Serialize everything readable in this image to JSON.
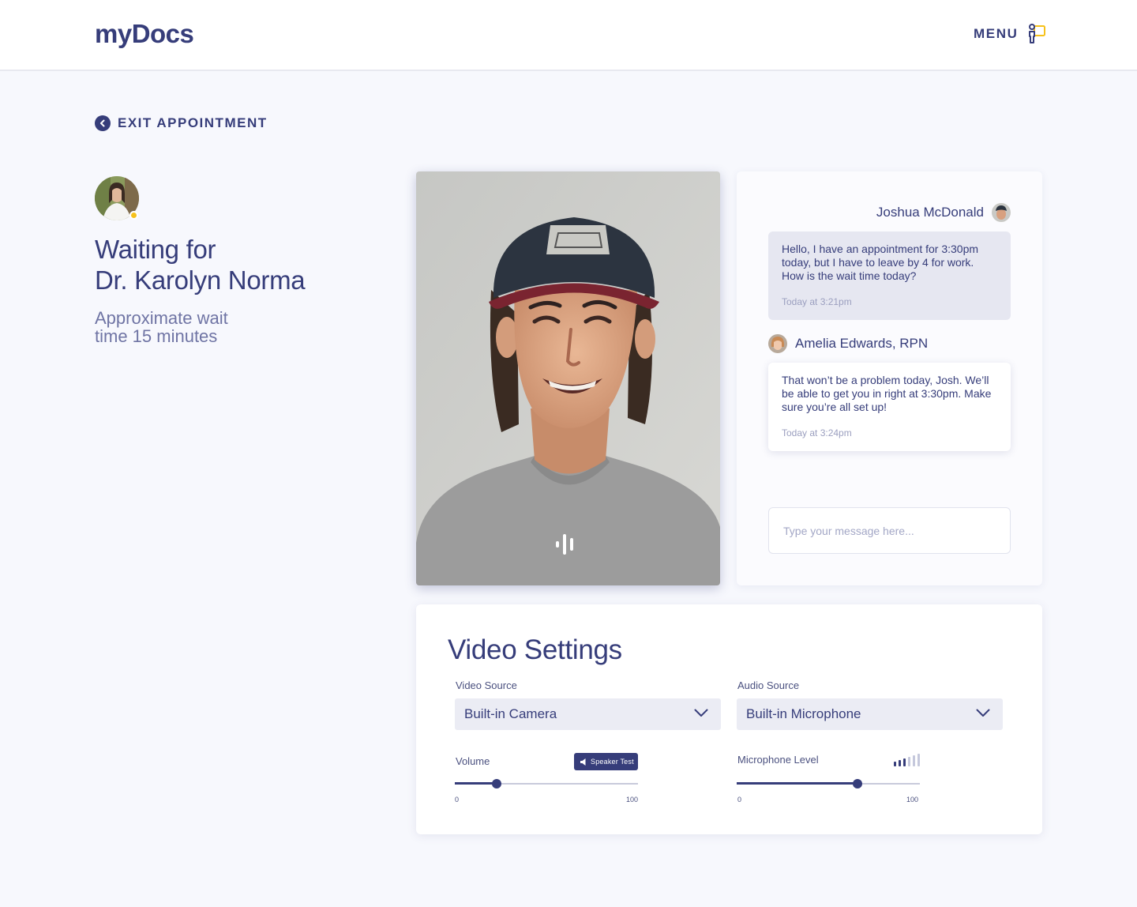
{
  "header": {
    "logo": "myDocs",
    "menu_label": "MENU",
    "menu_icon": "person-menu-icon"
  },
  "exit": {
    "label": "EXIT APPOINTMENT",
    "icon": "chevron-left-circle-icon"
  },
  "waiting": {
    "title_line1": "Waiting for",
    "title_line2": "Dr. Karolyn Norma",
    "subtitle_line1": "Approximate wait",
    "subtitle_line2": "time 15 minutes",
    "status_color": "#f6c11a"
  },
  "video": {
    "audio_indicator_icon": "audio-level-icon"
  },
  "chat": {
    "messages": [
      {
        "sender": "Joshua McDonald",
        "text": "Hello, I have an appointment for 3:30pm today, but I have to leave by 4 for work. How is the wait time today?",
        "time": "Today at 3:21pm"
      },
      {
        "sender": "Amelia Edwards, RPN",
        "text": "That won’t be a problem today, Josh. We’ll be able to get you in right at 3:30pm. Make sure you’re all set up!",
        "time": "Today at 3:24pm"
      }
    ],
    "input_placeholder": "Type your message here..."
  },
  "settings": {
    "title": "Video Settings",
    "video_source": {
      "label": "Video Source",
      "value": "Built-in Camera"
    },
    "audio_source": {
      "label": "Audio Source",
      "value": "Built-in Microphone"
    },
    "volume": {
      "label": "Volume",
      "button_label": "Speaker Test",
      "value": 23,
      "min_label": "0",
      "max_label": "100"
    },
    "mic_level": {
      "label": "Microphone Level",
      "value": 66,
      "min_label": "0",
      "max_label": "100",
      "bars_active": 3,
      "bars_total": 6
    }
  },
  "colors": {
    "primary": "#363d7a",
    "accent": "#f6c11a",
    "background": "#f7f8fd",
    "muted": "#6f74a4"
  }
}
